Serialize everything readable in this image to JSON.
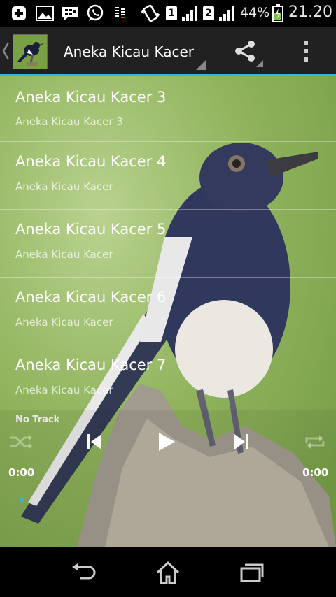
{
  "status_bar": {
    "sim1": "1",
    "sim2": "2",
    "battery": "44%",
    "time": "21.20",
    "icons": [
      "plus-icon",
      "image-icon",
      "bbm-icon",
      "whatsapp-icon",
      "network-activity-icon",
      "vibrate-icon",
      "signal-icon",
      "battery-icon"
    ]
  },
  "action_bar": {
    "title": "Aneka Kicau Kacer",
    "icons": [
      "back-icon",
      "app-icon",
      "share-icon",
      "overflow-menu-icon"
    ]
  },
  "tracks": [
    {
      "title": "Aneka Kicau Kacer 3",
      "subtitle": "Aneka Kicau Kacer 3"
    },
    {
      "title": "Aneka Kicau Kacer 4",
      "subtitle": "Aneka Kicau Kacer"
    },
    {
      "title": "Aneka Kicau Kacer 5",
      "subtitle": "Aneka Kicau Kacer"
    },
    {
      "title": "Aneka Kicau Kacer 6",
      "subtitle": "Aneka Kicau Kacer"
    },
    {
      "title": "Aneka Kicau Kacer 7",
      "subtitle": "Aneka Kicau Kacer"
    }
  ],
  "player": {
    "now_playing": "No Track",
    "elapsed": "0:00",
    "duration": "0:00",
    "progress": 0,
    "icons": [
      "shuffle-icon",
      "previous-icon",
      "play-icon",
      "next-icon",
      "repeat-icon"
    ]
  },
  "nav_bar": {
    "icons": [
      "back-nav-icon",
      "home-icon",
      "recent-apps-icon"
    ]
  },
  "colors": {
    "accent": "#33b5e5",
    "action_bar": "#212121",
    "background": "#7aa444"
  }
}
